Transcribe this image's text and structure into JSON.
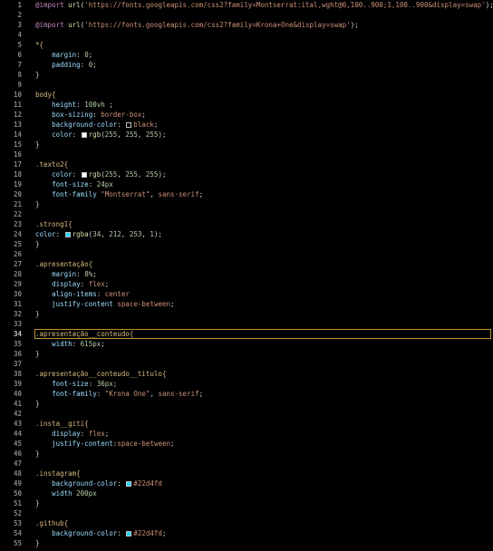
{
  "editor": {
    "language": "css",
    "active_line": 34,
    "colors": {
      "background": "#000000",
      "line_number": "#858585",
      "active_line_border": "#c0902a"
    },
    "lines": [
      {
        "n": "1",
        "tokens": [
          {
            "t": "@import",
            "c": "at"
          },
          {
            "t": " ",
            "c": "plain"
          },
          {
            "t": "url(",
            "c": "fn"
          },
          {
            "t": "'https://fonts.googleapis.com/css2?family=Montserrat:ital,wght@0,100..900;1,100..900&display=swap'",
            "c": "str"
          },
          {
            "t": ");",
            "c": "punc"
          }
        ]
      },
      {
        "n": "2",
        "tokens": []
      },
      {
        "n": "3",
        "tokens": [
          {
            "t": "@import",
            "c": "at"
          },
          {
            "t": " ",
            "c": "plain"
          },
          {
            "t": "url(",
            "c": "fn"
          },
          {
            "t": "'https://fonts.googleapis.com/css2?family=Krona+One&display=swap'",
            "c": "str"
          },
          {
            "t": ");",
            "c": "punc"
          }
        ]
      },
      {
        "n": "4",
        "tokens": []
      },
      {
        "n": "5",
        "tokens": [
          {
            "t": "*{",
            "c": "sel"
          }
        ]
      },
      {
        "n": "6",
        "tokens": [
          {
            "t": "    ",
            "c": "plain"
          },
          {
            "t": "margin",
            "c": "prop"
          },
          {
            "t": ": ",
            "c": "punc"
          },
          {
            "t": "0",
            "c": "num"
          },
          {
            "t": ";",
            "c": "punc"
          }
        ]
      },
      {
        "n": "7",
        "tokens": [
          {
            "t": "    ",
            "c": "plain"
          },
          {
            "t": "padding",
            "c": "prop"
          },
          {
            "t": ": ",
            "c": "punc"
          },
          {
            "t": "0",
            "c": "num"
          },
          {
            "t": ";",
            "c": "punc"
          }
        ]
      },
      {
        "n": "8",
        "tokens": [
          {
            "t": "}",
            "c": "punc"
          }
        ]
      },
      {
        "n": "9",
        "tokens": []
      },
      {
        "n": "10",
        "tokens": [
          {
            "t": "body{",
            "c": "sel"
          }
        ]
      },
      {
        "n": "11",
        "tokens": [
          {
            "t": "    ",
            "c": "plain"
          },
          {
            "t": "height",
            "c": "prop"
          },
          {
            "t": ": ",
            "c": "punc"
          },
          {
            "t": "100vh",
            "c": "num"
          },
          {
            "t": " ;",
            "c": "punc"
          }
        ]
      },
      {
        "n": "12",
        "tokens": [
          {
            "t": "    ",
            "c": "plain"
          },
          {
            "t": "box-sizing",
            "c": "prop"
          },
          {
            "t": ": ",
            "c": "punc"
          },
          {
            "t": "border-box",
            "c": "val"
          },
          {
            "t": ";",
            "c": "punc"
          }
        ]
      },
      {
        "n": "13",
        "tokens": [
          {
            "t": "    ",
            "c": "plain"
          },
          {
            "t": "background-color",
            "c": "prop"
          },
          {
            "t": ": ",
            "c": "punc"
          },
          {
            "swatch": "#000000"
          },
          {
            "t": "black",
            "c": "val"
          },
          {
            "t": ";",
            "c": "punc"
          }
        ]
      },
      {
        "n": "14",
        "tokens": [
          {
            "t": "    ",
            "c": "plain"
          },
          {
            "t": "color",
            "c": "prop"
          },
          {
            "t": ": ",
            "c": "punc"
          },
          {
            "swatch": "#ffffff"
          },
          {
            "t": "rgb",
            "c": "fn"
          },
          {
            "t": "(",
            "c": "punc"
          },
          {
            "t": "255",
            "c": "num"
          },
          {
            "t": ", ",
            "c": "punc"
          },
          {
            "t": "255",
            "c": "num"
          },
          {
            "t": ", ",
            "c": "punc"
          },
          {
            "t": "255",
            "c": "num"
          },
          {
            "t": ");",
            "c": "punc"
          }
        ]
      },
      {
        "n": "15",
        "tokens": [
          {
            "t": "}",
            "c": "punc"
          }
        ]
      },
      {
        "n": "16",
        "tokens": []
      },
      {
        "n": "17",
        "tokens": [
          {
            "t": ".texto2{",
            "c": "sel"
          }
        ]
      },
      {
        "n": "18",
        "tokens": [
          {
            "t": "    ",
            "c": "plain"
          },
          {
            "t": "color",
            "c": "prop"
          },
          {
            "t": ": ",
            "c": "punc"
          },
          {
            "swatch": "#ffffff"
          },
          {
            "t": "rgb",
            "c": "fn"
          },
          {
            "t": "(",
            "c": "punc"
          },
          {
            "t": "255",
            "c": "num"
          },
          {
            "t": ", ",
            "c": "punc"
          },
          {
            "t": "255",
            "c": "num"
          },
          {
            "t": ", ",
            "c": "punc"
          },
          {
            "t": "255",
            "c": "num"
          },
          {
            "t": ");",
            "c": "punc"
          }
        ]
      },
      {
        "n": "19",
        "tokens": [
          {
            "t": "    ",
            "c": "plain"
          },
          {
            "t": "font-size",
            "c": "prop"
          },
          {
            "t": ": ",
            "c": "punc"
          },
          {
            "t": "24px",
            "c": "num"
          },
          {
            "t": "",
            "c": "punc"
          }
        ]
      },
      {
        "n": "20",
        "tokens": [
          {
            "t": "    ",
            "c": "plain"
          },
          {
            "t": "font-family",
            "c": "prop"
          },
          {
            "t": " ",
            "c": "punc"
          },
          {
            "t": "\"Montserrat\"",
            "c": "str"
          },
          {
            "t": ", ",
            "c": "punc"
          },
          {
            "t": "sans-serif",
            "c": "val"
          },
          {
            "t": ";",
            "c": "punc"
          }
        ]
      },
      {
        "n": "21",
        "tokens": [
          {
            "t": "}",
            "c": "punc"
          }
        ]
      },
      {
        "n": "22",
        "tokens": []
      },
      {
        "n": "23",
        "tokens": [
          {
            "t": ".strong1{",
            "c": "sel"
          }
        ]
      },
      {
        "n": "24",
        "tokens": [
          {
            "t": "color",
            "c": "prop"
          },
          {
            "t": ": ",
            "c": "punc"
          },
          {
            "swatch": "#22d4fd"
          },
          {
            "t": "rgba",
            "c": "fn"
          },
          {
            "t": "(",
            "c": "punc"
          },
          {
            "t": "34",
            "c": "num"
          },
          {
            "t": ", ",
            "c": "punc"
          },
          {
            "t": "212",
            "c": "num"
          },
          {
            "t": ", ",
            "c": "punc"
          },
          {
            "t": "253",
            "c": "num"
          },
          {
            "t": ", ",
            "c": "punc"
          },
          {
            "t": "1",
            "c": "num"
          },
          {
            "t": ");",
            "c": "punc"
          }
        ]
      },
      {
        "n": "25",
        "tokens": [
          {
            "t": "}",
            "c": "punc"
          }
        ]
      },
      {
        "n": "26",
        "tokens": []
      },
      {
        "n": "27",
        "tokens": [
          {
            "t": ".apresentação{",
            "c": "sel"
          }
        ]
      },
      {
        "n": "28",
        "tokens": [
          {
            "t": "    ",
            "c": "plain"
          },
          {
            "t": "margin",
            "c": "prop"
          },
          {
            "t": ": ",
            "c": "punc"
          },
          {
            "t": "8%",
            "c": "num"
          },
          {
            "t": ";",
            "c": "punc"
          }
        ]
      },
      {
        "n": "29",
        "tokens": [
          {
            "t": "    ",
            "c": "plain"
          },
          {
            "t": "display",
            "c": "prop"
          },
          {
            "t": ": ",
            "c": "punc"
          },
          {
            "t": "flex",
            "c": "val"
          },
          {
            "t": ";",
            "c": "punc"
          }
        ]
      },
      {
        "n": "30",
        "tokens": [
          {
            "t": "    ",
            "c": "plain"
          },
          {
            "t": "align-items",
            "c": "prop"
          },
          {
            "t": ": ",
            "c": "punc"
          },
          {
            "t": "center",
            "c": "val"
          }
        ]
      },
      {
        "n": "31",
        "tokens": [
          {
            "t": "    ",
            "c": "plain"
          },
          {
            "t": "justify-content",
            "c": "prop"
          },
          {
            "t": " ",
            "c": "punc"
          },
          {
            "t": "space-between",
            "c": "val"
          },
          {
            "t": ";",
            "c": "punc"
          }
        ]
      },
      {
        "n": "32",
        "tokens": [
          {
            "t": "}",
            "c": "punc"
          }
        ]
      },
      {
        "n": "33",
        "tokens": []
      },
      {
        "n": "34",
        "tokens": [
          {
            "t": ".apresentação__conteudo{",
            "c": "sel"
          }
        ]
      },
      {
        "n": "35",
        "tokens": [
          {
            "t": "    ",
            "c": "plain"
          },
          {
            "t": "width",
            "c": "prop"
          },
          {
            "t": ": ",
            "c": "punc"
          },
          {
            "t": "615px",
            "c": "num"
          },
          {
            "t": ";",
            "c": "punc"
          }
        ]
      },
      {
        "n": "36",
        "tokens": [
          {
            "t": "}",
            "c": "punc"
          }
        ]
      },
      {
        "n": "37",
        "tokens": []
      },
      {
        "n": "38",
        "tokens": [
          {
            "t": ".apresentação__conteudo__titulo{",
            "c": "sel"
          }
        ]
      },
      {
        "n": "39",
        "tokens": [
          {
            "t": "    ",
            "c": "plain"
          },
          {
            "t": "font-size",
            "c": "prop"
          },
          {
            "t": ": ",
            "c": "punc"
          },
          {
            "t": "36px",
            "c": "num"
          },
          {
            "t": ";",
            "c": "punc"
          }
        ]
      },
      {
        "n": "40",
        "tokens": [
          {
            "t": "    ",
            "c": "plain"
          },
          {
            "t": "font-family",
            "c": "prop"
          },
          {
            "t": ": ",
            "c": "punc"
          },
          {
            "t": "\"Krona One\"",
            "c": "str"
          },
          {
            "t": ", ",
            "c": "punc"
          },
          {
            "t": "sans-serif",
            "c": "val"
          },
          {
            "t": ";",
            "c": "punc"
          }
        ]
      },
      {
        "n": "41",
        "tokens": [
          {
            "t": "}",
            "c": "punc"
          }
        ]
      },
      {
        "n": "42",
        "tokens": []
      },
      {
        "n": "43",
        "tokens": [
          {
            "t": ".insta__giti{",
            "c": "sel"
          }
        ]
      },
      {
        "n": "44",
        "tokens": [
          {
            "t": "    ",
            "c": "plain"
          },
          {
            "t": "display",
            "c": "prop"
          },
          {
            "t": ": ",
            "c": "punc"
          },
          {
            "t": "flex",
            "c": "val"
          },
          {
            "t": ";",
            "c": "punc"
          }
        ]
      },
      {
        "n": "45",
        "tokens": [
          {
            "t": "    ",
            "c": "plain"
          },
          {
            "t": "justify-content",
            "c": "prop"
          },
          {
            "t": ":",
            "c": "punc"
          },
          {
            "t": "space-between",
            "c": "val"
          },
          {
            "t": ";",
            "c": "punc"
          }
        ]
      },
      {
        "n": "46",
        "tokens": [
          {
            "t": "}",
            "c": "punc"
          }
        ]
      },
      {
        "n": "47",
        "tokens": []
      },
      {
        "n": "48",
        "tokens": [
          {
            "t": ".instagram{",
            "c": "sel"
          }
        ]
      },
      {
        "n": "49",
        "tokens": [
          {
            "t": "    ",
            "c": "plain"
          },
          {
            "t": "background-color",
            "c": "prop"
          },
          {
            "t": ": ",
            "c": "punc"
          },
          {
            "swatch": "#22d4fd"
          },
          {
            "t": "#22d4fd",
            "c": "val"
          }
        ]
      },
      {
        "n": "50",
        "tokens": [
          {
            "t": "    ",
            "c": "plain"
          },
          {
            "t": "width",
            "c": "prop"
          },
          {
            "t": " ",
            "c": "punc"
          },
          {
            "t": "200px",
            "c": "num"
          }
        ]
      },
      {
        "n": "51",
        "tokens": [
          {
            "t": "}",
            "c": "punc"
          }
        ]
      },
      {
        "n": "52",
        "tokens": []
      },
      {
        "n": "53",
        "tokens": [
          {
            "t": ".github{",
            "c": "sel"
          }
        ]
      },
      {
        "n": "54",
        "tokens": [
          {
            "t": "    ",
            "c": "plain"
          },
          {
            "t": "background-color",
            "c": "prop"
          },
          {
            "t": ": ",
            "c": "punc"
          },
          {
            "swatch": "#22d4fd"
          },
          {
            "t": "#22d4fd",
            "c": "val"
          },
          {
            "t": ";",
            "c": "punc"
          }
        ]
      },
      {
        "n": "55",
        "tokens": [
          {
            "t": "}",
            "c": "punc"
          }
        ]
      }
    ]
  }
}
